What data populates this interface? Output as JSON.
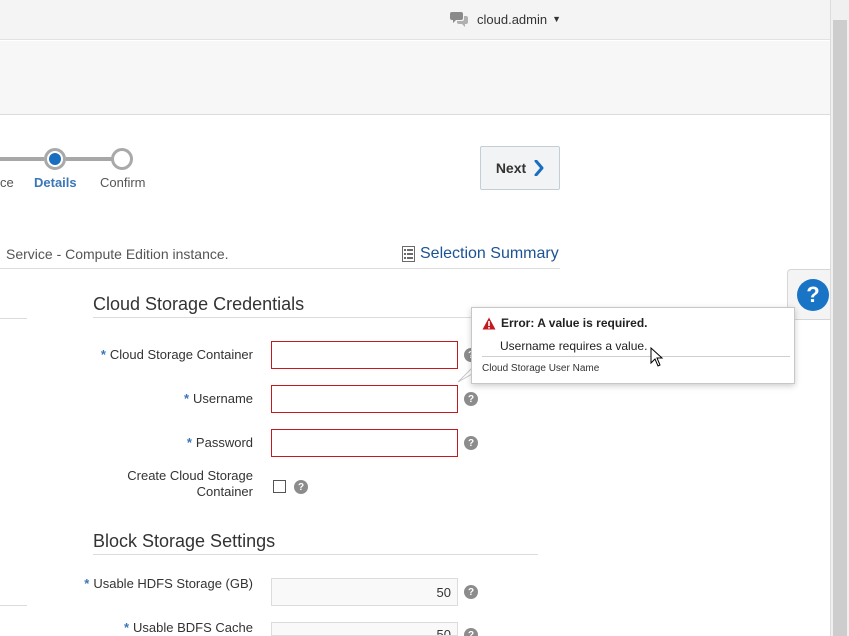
{
  "header": {
    "username": "cloud.admin",
    "close_glyph": "×"
  },
  "train": {
    "prev_label": "ce",
    "current_label": "Details",
    "next_label": "Confirm"
  },
  "next_button": {
    "label": "Next"
  },
  "description": "Service - Compute Edition instance.",
  "selection_summary": "Selection Summary",
  "sections": {
    "credentials_title": "Cloud Storage Credentials",
    "block_title": "Block Storage Settings"
  },
  "fields": {
    "container_label": "Cloud Storage Container",
    "username_label": "Username",
    "password_label": "Password",
    "create_container_label": "Create Cloud Storage Container",
    "hdfs_label": "Usable HDFS Storage (GB)",
    "hdfs_value": "50",
    "bdfs_label": "Usable BDFS Cache",
    "bdfs_value": "50",
    "required_marker": "*"
  },
  "error_popup": {
    "title": "Error: A value is required.",
    "message": "Username requires a value.",
    "hint": "Cloud Storage User Name"
  },
  "help_glyph": "?",
  "colors": {
    "accent": "#1a6ec0",
    "error": "#c4191f",
    "link": "#1c5393"
  }
}
